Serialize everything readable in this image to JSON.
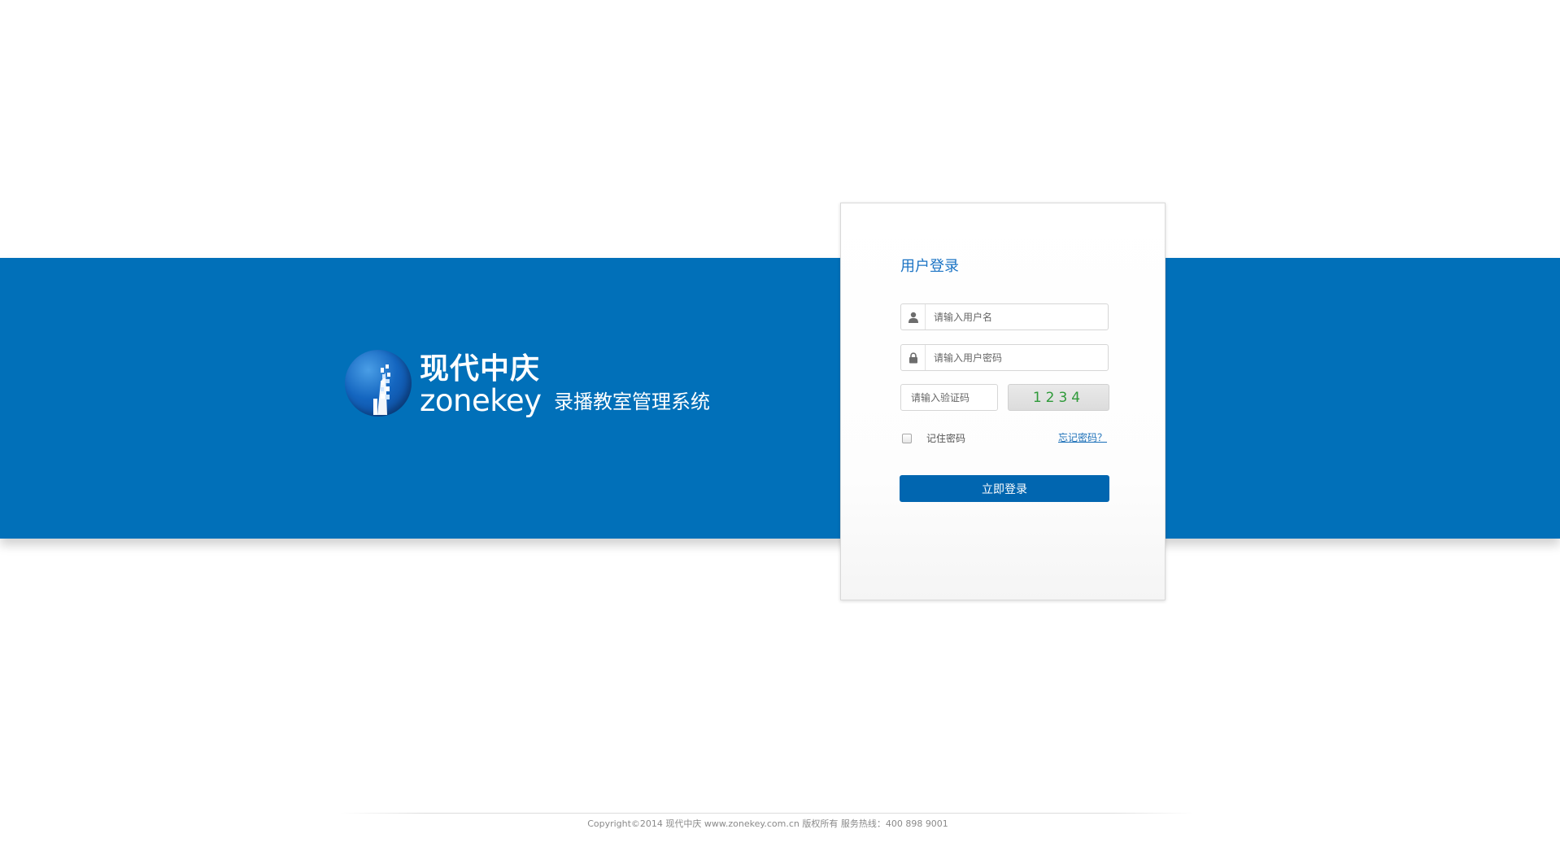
{
  "brand": {
    "name_cn": "现代中庆",
    "name_en": "zonekey",
    "system_name": "录播教室管理系统"
  },
  "login": {
    "title": "用户登录",
    "username_placeholder": "请输入用户名",
    "password_placeholder": "请输入用户密码",
    "captcha_placeholder": "请输入验证码",
    "captcha_code": "1234",
    "remember_label": "记住密码",
    "forgot_link": "忘记密码？",
    "submit_label": "立即登录"
  },
  "footer": {
    "copyright": "Copyright©2014 现代中庆 www.zonekey.com.cn 版权所有 服务热线：400 898 9001"
  },
  "colors": {
    "banner": "#0170b9",
    "accent": "#0166b0",
    "captcha_text": "#2f9a3a"
  },
  "icons": {
    "username": "user-icon",
    "password": "lock-icon"
  }
}
